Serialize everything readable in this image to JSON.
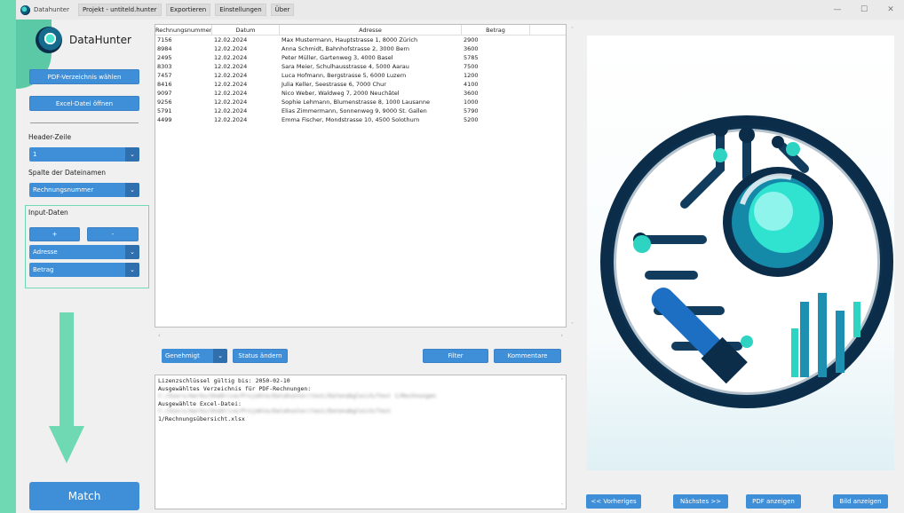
{
  "window": {
    "app_name": "Datahunter",
    "menu": [
      "Projekt - untiteld.hunter",
      "Exportieren",
      "Einstellungen",
      "Über"
    ],
    "controls": {
      "minimize": "—",
      "maximize": "☐",
      "close": "✕"
    }
  },
  "sidebar": {
    "logo_text": "DataHunter",
    "pdf_dir_button": "PDF-Verzeichnis wählen",
    "excel_button": "Excel-Datei öffnen",
    "header_label": "Header-Zeile",
    "header_value": "1",
    "filename_col_label": "Spalte der Dateinamen",
    "filename_col_value": "Rechnungsnummer",
    "input_label": "Input-Daten",
    "add_button": "+",
    "remove_button": "-",
    "input_fields": [
      "Adresse",
      "Betrag"
    ],
    "match_button": "Match"
  },
  "table": {
    "columns": [
      "Rechnungsnummer",
      "Datum",
      "Adresse",
      "Betrag"
    ],
    "rows": [
      [
        "7156",
        "12.02.2024",
        "Max Mustermann, Hauptstrasse 1, 8000 Zürich",
        "2900"
      ],
      [
        "8984",
        "12.02.2024",
        "Anna Schmidt, Bahnhofstrasse 2, 3000 Bern",
        "3600"
      ],
      [
        "2495",
        "12.02.2024",
        "Peter Müller, Gartenweg 3, 4000 Basel",
        "5785"
      ],
      [
        "8303",
        "12.02.2024",
        "Sara Meier, Schulhausstrasse 4, 5000 Aarau",
        "7500"
      ],
      [
        "7457",
        "12.02.2024",
        "Luca Hofmann, Bergstrasse 5, 6000 Luzern",
        "1200"
      ],
      [
        "8416",
        "12.02.2024",
        "Julia Keller, Seestrasse 6, 7000 Chur",
        "4100"
      ],
      [
        "9097",
        "12.02.2024",
        "Nico Weber, Waldweg 7, 2000 Neuchâtel",
        "3600"
      ],
      [
        "9256",
        "12.02.2024",
        "Sophie Lehmann, Blumenstrasse 8, 1000 Lausanne",
        "1000"
      ],
      [
        "5791",
        "12.02.2024",
        "Elias Zimmermann, Sonnenweg 9, 9000 St. Gallen",
        "5790"
      ],
      [
        "4499",
        "12.02.2024",
        "Emma Fischer, Mondstrasse 10, 4500 Solothurn",
        "5200"
      ]
    ]
  },
  "actions": {
    "status_value": "Genehmigt",
    "status_change": "Status ändern",
    "filter": "Filter",
    "comments": "Kommentare"
  },
  "log": {
    "lines": [
      {
        "text": "Lizenzschlüssel gültig bis: 2050-02-10",
        "blurred": false
      },
      {
        "text": "Ausgewähltes Verzeichnis für PDF-Rechnungen:",
        "blurred": false
      },
      {
        "text": "C:/Users/marko/OneDrive/Projekte/Datahunter/test/Datenabgleich/Test 1/Rechnungen",
        "blurred": true
      },
      {
        "text": "Ausgewählte Excel-Datei:",
        "blurred": false
      },
      {
        "text": "C:/Users/marko/OneDrive/Projekte/Datahunter/test/Datenabgleich/Test",
        "blurred": true
      },
      {
        "text": "1/Rechnungsübersicht.xlsx",
        "blurred": false
      }
    ]
  },
  "viewer": {
    "prev": "<< Vorheriges",
    "next": "Nächstes >>",
    "show_pdf": "PDF anzeigen",
    "show_image": "Bild anzeigen"
  },
  "colors": {
    "accent": "#3f8fd8",
    "background": "#6fd9b4",
    "logo_dark": "#0b2d4a",
    "logo_teal": "#2fd3c2"
  }
}
